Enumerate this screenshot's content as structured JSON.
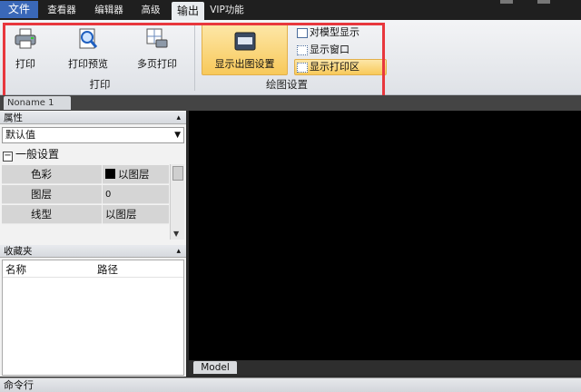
{
  "menubar": {
    "items": [
      "文件",
      "查看器",
      "编辑器",
      "高级",
      "输出",
      "VIP功能"
    ],
    "active": "输出"
  },
  "ribbon": {
    "print_group": {
      "label": "打印",
      "buttons": [
        "打印",
        "打印预览",
        "多页打印"
      ]
    },
    "draw_group": {
      "label": "绘图设置",
      "big_button": "显示出图设置",
      "small_buttons": [
        "对模型显示",
        "显示窗口",
        "显示打印区"
      ]
    }
  },
  "doc_tab": {
    "label": "Noname 1"
  },
  "properties": {
    "title": "属性",
    "combo_value": "默认值",
    "section": "一般设置",
    "section_toggle": "−",
    "rows": [
      {
        "key": "色彩",
        "value": "以图层"
      },
      {
        "key": "图层",
        "value": "0"
      },
      {
        "key": "线型",
        "value": "以图层"
      }
    ]
  },
  "favorites": {
    "title": "收藏夹",
    "columns": [
      "名称",
      "路径"
    ]
  },
  "canvas": {
    "model_tab": "Model"
  },
  "command_line": {
    "label": "命令行"
  },
  "colors": {
    "highlight_box": "#e8373d",
    "active_button": "#f8c95a",
    "canvas": "#000000"
  }
}
